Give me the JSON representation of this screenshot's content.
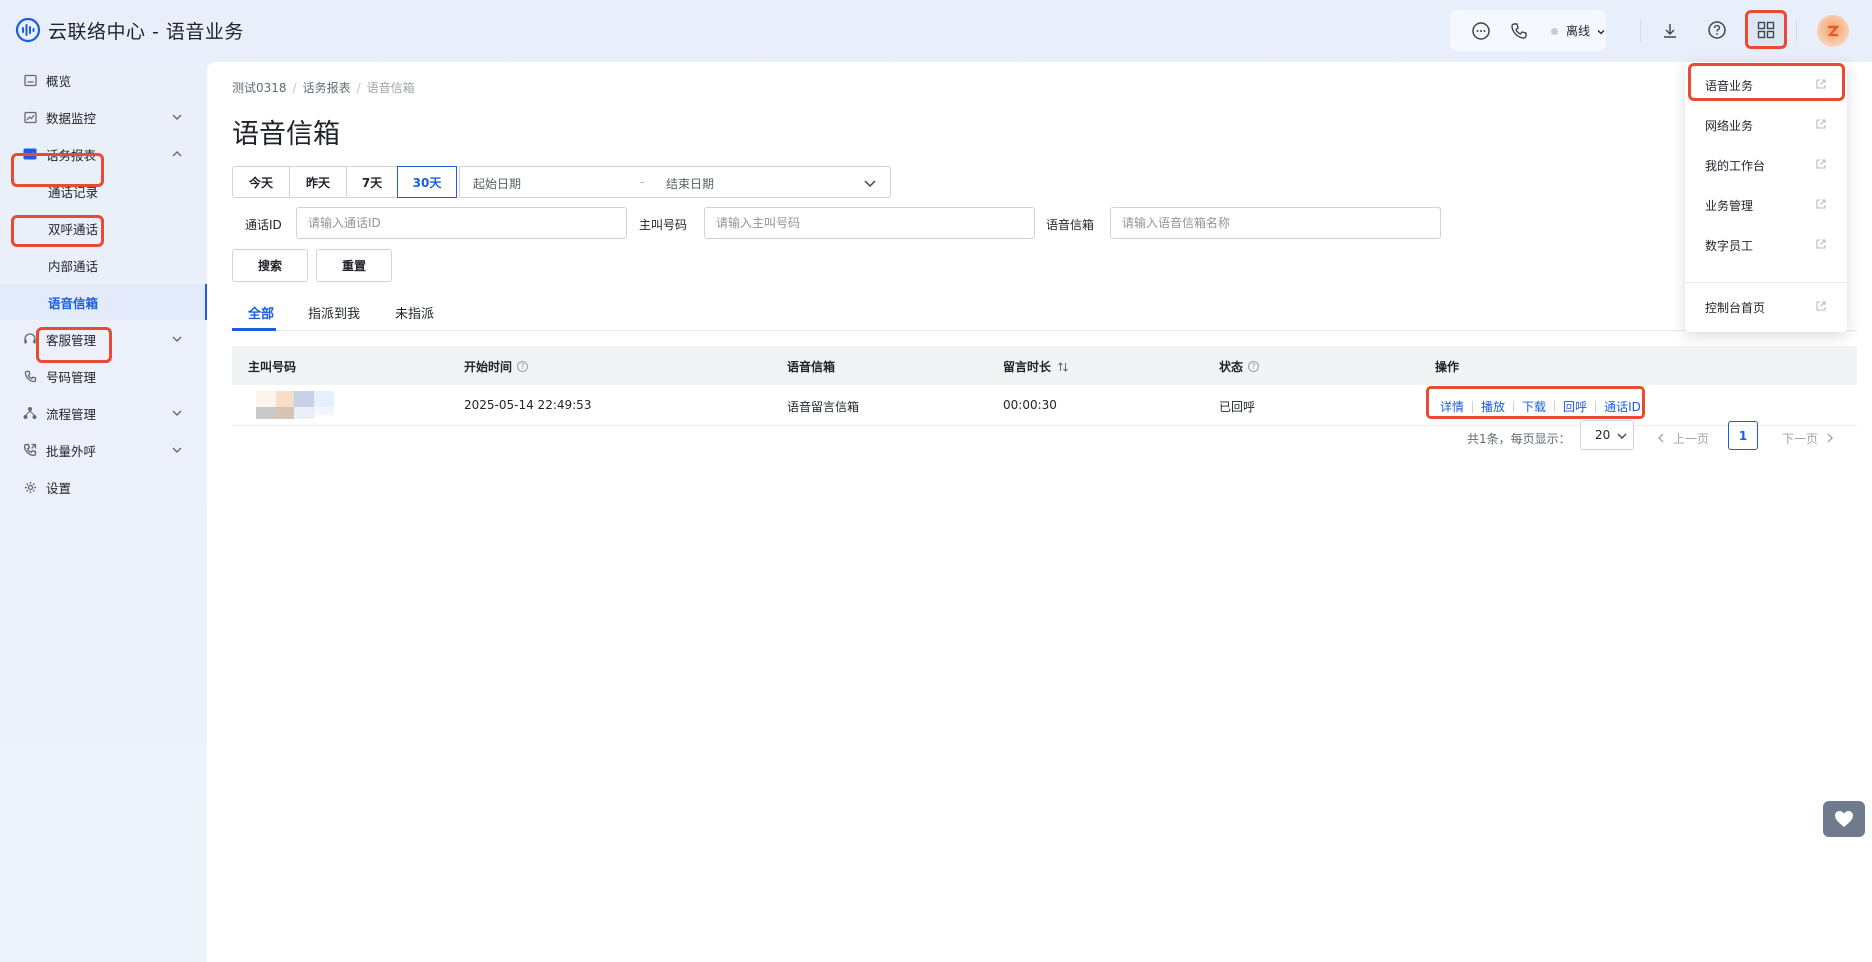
{
  "header": {
    "app_title": "云联络中心 - 语音业务",
    "status_label": "离线",
    "icons": [
      "logo-icon",
      "chat-icon",
      "phone-icon",
      "download-icon",
      "help-icon",
      "apps-grid-icon"
    ]
  },
  "sidebar": {
    "items": [
      {
        "label": "概览",
        "icon": "overview-icon"
      },
      {
        "label": "数据监控",
        "icon": "monitor-icon"
      },
      {
        "label": "话务报表",
        "icon": "report-icon"
      },
      {
        "label": "通话记录"
      },
      {
        "label": "双呼通话"
      },
      {
        "label": "内部通话"
      },
      {
        "label": "语音信箱"
      },
      {
        "label": "客服管理",
        "icon": "headset-icon"
      },
      {
        "label": "号码管理",
        "icon": "phone-icon"
      },
      {
        "label": "流程管理",
        "icon": "flow-icon"
      },
      {
        "label": "批量外呼",
        "icon": "outbound-icon"
      },
      {
        "label": "设置",
        "icon": "gear-icon"
      }
    ]
  },
  "breadcrumb": {
    "items": [
      "测试0318",
      "话务报表",
      "语音信箱"
    ]
  },
  "page_title": "语音信箱",
  "filters": {
    "range_buttons": [
      "今天",
      "昨天",
      "7天",
      "30天"
    ],
    "date_start_placeholder": "起始日期",
    "date_separator": "-",
    "date_end_placeholder": "结束日期",
    "call_id_label": "通话ID",
    "call_id_placeholder": "请输入通话ID",
    "caller_label": "主叫号码",
    "caller_placeholder": "请输入主叫号码",
    "mailbox_label": "语音信箱",
    "mailbox_placeholder": "请输入语音信箱名称",
    "search_button": "搜索",
    "reset_button": "重置"
  },
  "tabs": [
    "全部",
    "指派到我",
    "未指派"
  ],
  "table": {
    "columns": [
      "主叫号码",
      "开始时间",
      "语音信箱",
      "留言时长",
      "状态",
      "操作"
    ],
    "rows": [
      {
        "caller": "",
        "start_time": "2025-05-14 22:49:53",
        "mailbox": "语音留言信箱",
        "duration": "00:00:30",
        "status": "已回呼",
        "actions": [
          "详情",
          "播放",
          "下载",
          "回呼",
          "通话ID"
        ]
      }
    ]
  },
  "pagination": {
    "total_text": "共1条，每页显示：",
    "page_size": "20",
    "prev_label": "上一页",
    "current_page": "1",
    "next_label": "下一页"
  },
  "dropdown_menu": {
    "items": [
      "语音业务",
      "网络业务",
      "我的工作台",
      "业务管理",
      "数字员工"
    ],
    "footer_item": "控制台首页"
  },
  "colors": {
    "accent": "#1b5de0",
    "highlight": "#e84a34"
  }
}
